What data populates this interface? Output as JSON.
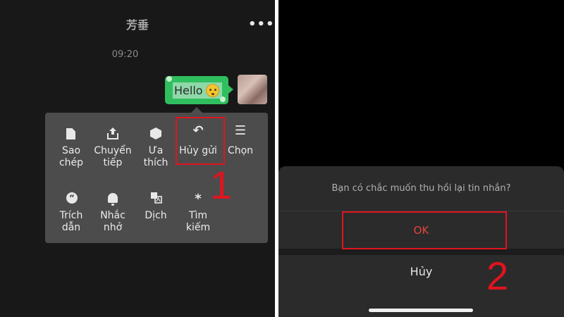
{
  "left": {
    "chat_title": "芳垂",
    "more_label": "•••",
    "time": "09:20",
    "message": {
      "text": "Hello",
      "emoji": "flushed-face-emoji"
    },
    "menu": {
      "items": [
        {
          "label": "Sao chép",
          "icon": "copy-icon"
        },
        {
          "label": "Chuyển tiếp",
          "icon": "forward-icon"
        },
        {
          "label": "Ưa thích",
          "icon": "favorite-icon"
        },
        {
          "label": "Hủy gửi",
          "icon": "undo-icon",
          "glyph": "↶"
        },
        {
          "label": "Chọn",
          "icon": "multi-select-icon",
          "glyph": "☰"
        },
        {
          "label": "Trích dẫn",
          "icon": "quote-icon",
          "glyph": "“"
        },
        {
          "label": "Nhắc nhở",
          "icon": "bell-icon"
        },
        {
          "label": "Dịch",
          "icon": "translate-icon"
        },
        {
          "label": "Tìm kiếm",
          "icon": "search-sparkle-icon",
          "glyph": "⁎"
        }
      ]
    },
    "step_number": "1"
  },
  "right": {
    "sheet": {
      "question": "Bạn có chắc muốn thu hồi lại tin nhắn?",
      "ok_label": "OK",
      "cancel_label": "Hủy"
    },
    "step_number": "2"
  },
  "colors": {
    "highlight": "#e0141e",
    "bubble": "#2fbf5e",
    "ok_text": "#e2443c"
  }
}
